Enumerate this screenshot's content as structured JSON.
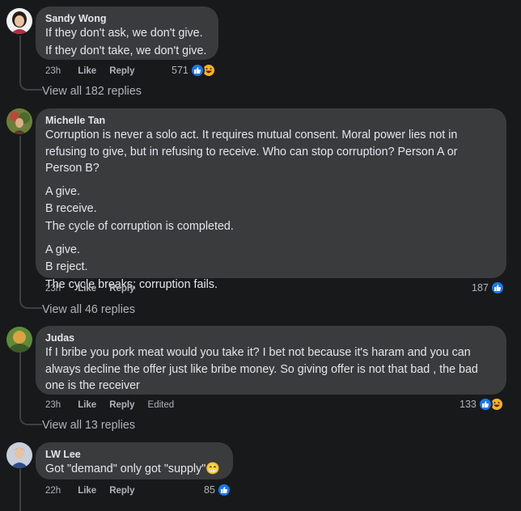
{
  "comments": [
    {
      "author": "Sandy Wong",
      "lines": [
        [
          "If they don't ask, we don't give.",
          "If they don't take, we don't give."
        ]
      ],
      "time": "23h",
      "like_label": "Like",
      "reply_label": "Reply",
      "reaction_count": "571",
      "reactions": [
        "like",
        "haha"
      ],
      "view_replies": "View all 182 replies"
    },
    {
      "author": "Michelle Tan",
      "lines": [
        [
          "Corruption is never a solo act. It requires mutual consent. Moral power lies not in refusing to give, but in refusing to receive. Who can stop corruption? Person A or Person B?"
        ],
        [
          "A give.",
          "B receive.",
          "The cycle of corruption is completed."
        ],
        [
          "A give.",
          "B reject.",
          "The cycle breaks; corruption fails."
        ]
      ],
      "time": "23h",
      "like_label": "Like",
      "reply_label": "Reply",
      "reaction_count": "187",
      "reactions": [
        "like"
      ],
      "view_replies": "View all 46 replies"
    },
    {
      "author": "Judas",
      "lines": [
        [
          "If I bribe you pork meat would you take it? I bet not because it's haram and you can always decline the offer just like bribe money. So giving offer is not that bad , the bad one is the receiver"
        ]
      ],
      "time": "23h",
      "like_label": "Like",
      "reply_label": "Reply",
      "edited_label": "Edited",
      "reaction_count": "133",
      "reactions": [
        "like",
        "haha"
      ],
      "view_replies": "View all 13 replies"
    },
    {
      "author": "LW Lee",
      "lines": [
        [
          "Got \"demand\" only got \"supply\"😁"
        ]
      ],
      "time": "22h",
      "like_label": "Like",
      "reply_label": "Reply",
      "reaction_count": "85",
      "reactions": [
        "like"
      ]
    }
  ]
}
